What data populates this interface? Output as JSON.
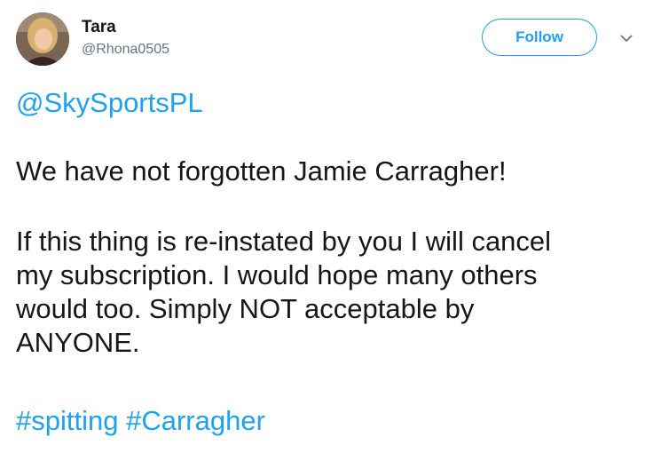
{
  "user": {
    "display_name": "Tara",
    "handle": "@Rhona0505"
  },
  "header": {
    "follow_label": "Follow",
    "menu_icon": "chevron-down-icon"
  },
  "tweet": {
    "mention": "@SkySportsPL",
    "line1": "We have not forgotten Jamie Carragher!",
    "paragraph2_lines": [
      "If this thing is re-instated by you I will cancel",
      "my subscription. I would hope many others",
      "would too. Simply NOT acceptable by",
      "ANYONE."
    ],
    "hashtags": [
      "#spitting",
      "#Carragher"
    ]
  },
  "colors": {
    "accent": "#1da1f2",
    "text": "#14171a",
    "muted": "#657786"
  }
}
